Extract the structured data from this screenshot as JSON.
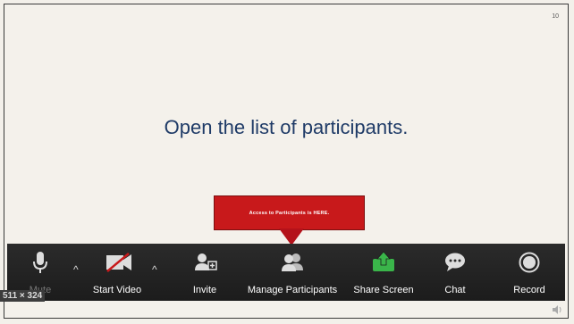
{
  "slide": {
    "number": "10",
    "title": "Open the list of participants."
  },
  "callout": {
    "text": "Access to Participants is  HERE.",
    "color": "#c8191b"
  },
  "toolbar": {
    "mute_label": "Mute",
    "start_video_label": "Start Video",
    "invite_label": "Invite",
    "manage_participants_label": "Manage Participants",
    "share_screen_label": "Share Screen",
    "chat_label": "Chat",
    "record_label": "Record",
    "caret_glyph": "^"
  },
  "overlay": {
    "dimension_badge": "511 × 324"
  },
  "colors": {
    "share_green": "#3ab54a",
    "title_blue": "#1f3b67"
  }
}
